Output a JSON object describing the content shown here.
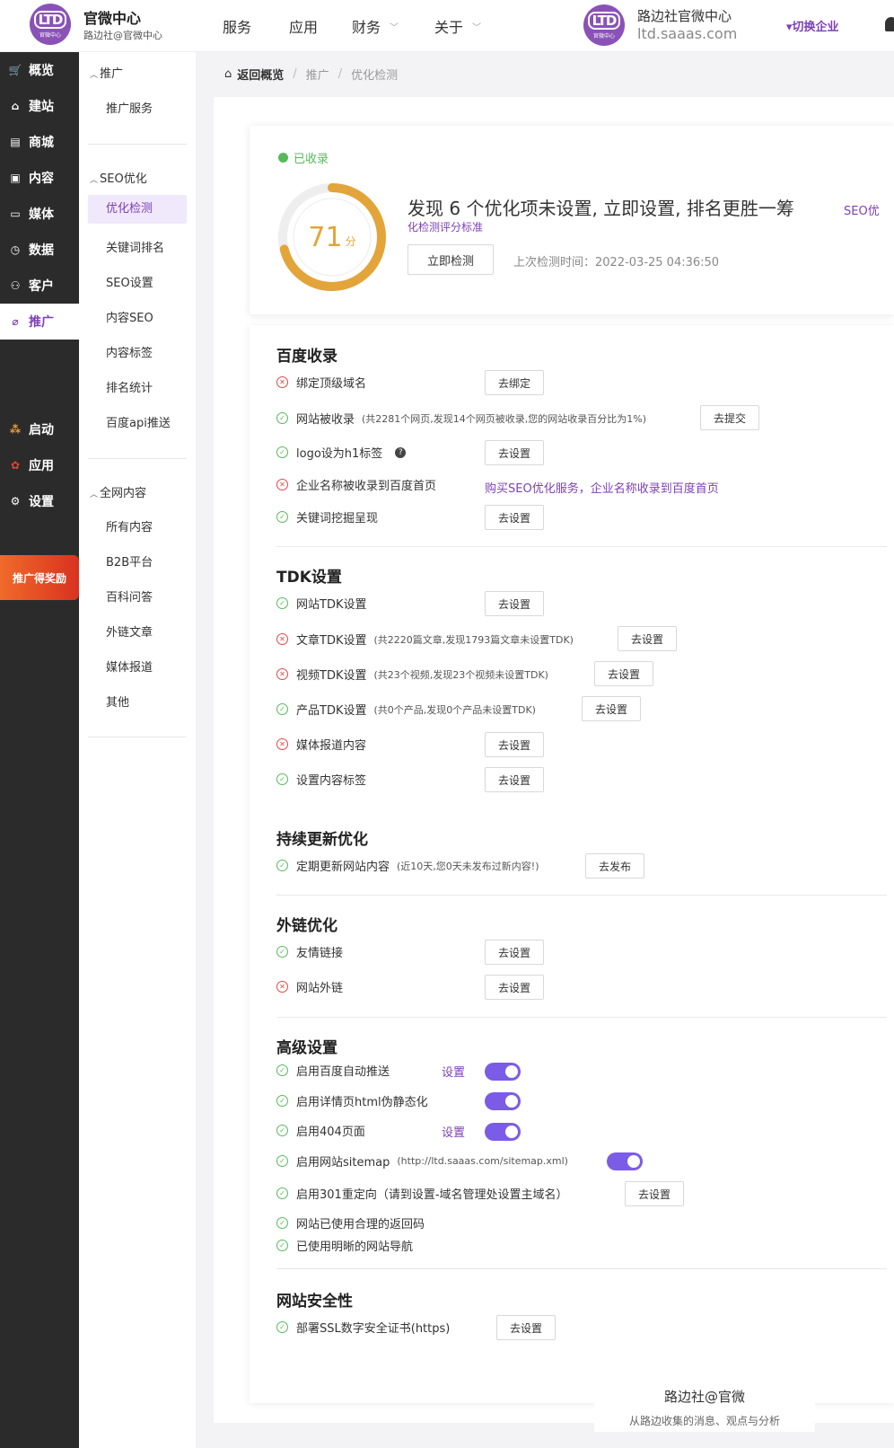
{
  "header": {
    "logo_text": "LTD",
    "logo_sub": "官微中心",
    "brand_title": "官微中心",
    "brand_sub": "路边社@官微中心",
    "nav": [
      {
        "label": "服务"
      },
      {
        "label": "应用"
      },
      {
        "label": "财务"
      },
      {
        "label": "关于"
      }
    ],
    "company_name": "路边社官微中心",
    "company_domain": "ltd.saaas.com",
    "switch_label": "▾切换企业"
  },
  "rail": {
    "items": [
      {
        "label": "概览",
        "icon": "cart-icon"
      },
      {
        "label": "建站",
        "icon": "home-icon"
      },
      {
        "label": "商城",
        "icon": "shop-icon"
      },
      {
        "label": "内容",
        "icon": "document-icon"
      },
      {
        "label": "媒体",
        "icon": "media-icon"
      },
      {
        "label": "数据",
        "icon": "clock-icon"
      },
      {
        "label": "客户",
        "icon": "user-icon"
      },
      {
        "label": "推广",
        "icon": "tag-icon"
      }
    ],
    "extra": [
      {
        "label": "启动",
        "icon": "launch-icon"
      },
      {
        "label": "应用",
        "icon": "apps-icon"
      },
      {
        "label": "设置",
        "icon": "gear-icon"
      }
    ],
    "banner": "推广得奖励"
  },
  "submenu": {
    "group1": "推广",
    "group1_items": [
      "推广服务"
    ],
    "group2": "SEO优化",
    "group2_items": [
      "优化检测",
      "关键词排名",
      "SEO设置",
      "内容SEO",
      "内容标签",
      "排名统计",
      "百度api推送"
    ],
    "group3": "全网内容",
    "group3_items": [
      "所有内容",
      "B2B平台",
      "百科问答",
      "外链文章",
      "媒体报道",
      "其他"
    ]
  },
  "breadcrumb": {
    "home": "返回概览",
    "level1": "推广",
    "level2": "优化检测",
    "sep": "/"
  },
  "score": {
    "indexed_label": "已收录",
    "value": 71,
    "unit": "分",
    "headline": "发现 6 个优化项未设置, 立即设置, 排名更胜一筹",
    "seo_link": "SEO优",
    "standard_link": "化检测评分标准",
    "check_button": "立即检测",
    "last_check": "上次检测时间：2022-03-25 04:36:50"
  },
  "sections": {
    "baidu": {
      "title": "百度收录",
      "rows": [
        {
          "status": "no",
          "label": "绑定顶级域名",
          "note": "",
          "button": "去绑定"
        },
        {
          "status": "ok",
          "label": "网站被收录",
          "note": "(共2281个网页,发现14个网页被收录,您的网站收录百分比为1%)",
          "button": "去提交"
        },
        {
          "status": "ok",
          "label": "logo设为h1标签",
          "note": "",
          "button": "去设置"
        },
        {
          "status": "no",
          "label": "企业名称被收录到百度首页",
          "note": "",
          "link": "购买SEO优化服务，企业名称收录到百度首页"
        },
        {
          "status": "ok",
          "label": "关键词挖掘呈现",
          "note": "",
          "button": "去设置"
        }
      ]
    },
    "tdk": {
      "title": "TDK设置",
      "rows": [
        {
          "status": "ok",
          "label": "网站TDK设置",
          "note": "",
          "button": "去设置"
        },
        {
          "status": "no",
          "label": "文章TDK设置",
          "note": "(共2220篇文章,发现1793篇文章未设置TDK)",
          "button": "去设置"
        },
        {
          "status": "no",
          "label": "视频TDK设置",
          "note": "(共23个视频,发现23个视频未设置TDK)",
          "button": "去设置"
        },
        {
          "status": "ok",
          "label": "产品TDK设置",
          "note": "(共0个产品,发现0个产品未设置TDK)",
          "button": "去设置"
        },
        {
          "status": "no",
          "label": "媒体报道内容",
          "note": "",
          "button": "去设置"
        },
        {
          "status": "ok",
          "label": "设置内容标签",
          "note": "",
          "button": "去设置"
        }
      ]
    },
    "update": {
      "title": "持续更新优化",
      "rows": [
        {
          "status": "ok",
          "label": "定期更新网站内容",
          "note": "(近10天,您0天未发布过新内容!)",
          "button": "去发布"
        }
      ]
    },
    "links": {
      "title": "外链优化",
      "rows": [
        {
          "status": "ok",
          "label": "友情链接",
          "note": "",
          "button": "去设置"
        },
        {
          "status": "no",
          "label": "网站外链",
          "note": "",
          "button": "去设置"
        }
      ]
    },
    "advanced": {
      "title": "高级设置",
      "rows": [
        {
          "status": "ok",
          "label": "启用百度自动推送",
          "note": "",
          "link": "设置",
          "toggle": true
        },
        {
          "status": "ok",
          "label": "启用详情页html伪静态化",
          "note": "",
          "toggle": true
        },
        {
          "status": "ok",
          "label": "启用404页面",
          "note": "",
          "link": "设置",
          "toggle": true
        },
        {
          "status": "ok",
          "label": "启用网站sitemap",
          "note": "(http://ltd.saaas.com/sitemap.xml)",
          "toggle": true
        },
        {
          "status": "ok",
          "label": "启用301重定向（请到设置-域名管理处设置主域名）",
          "note": "",
          "button": "去设置"
        },
        {
          "status": "ok",
          "label": "网站已使用合理的返回码",
          "note": ""
        },
        {
          "status": "ok",
          "label": "已使用明晰的网站导航",
          "note": ""
        }
      ]
    },
    "security": {
      "title": "网站安全性",
      "rows": [
        {
          "status": "ok",
          "label": "部署SSL数字安全证书(https)",
          "note": "",
          "button": "去设置"
        }
      ]
    }
  },
  "watermark": {
    "line1": "路边社@官微",
    "line2": "从路边收集的消息、观点与分析"
  },
  "colors": {
    "accent": "#7d3fb6",
    "ok": "#58b95c",
    "error": "#e04848",
    "score_ring": "#e3a43a",
    "toggle": "#7b5ce6"
  }
}
